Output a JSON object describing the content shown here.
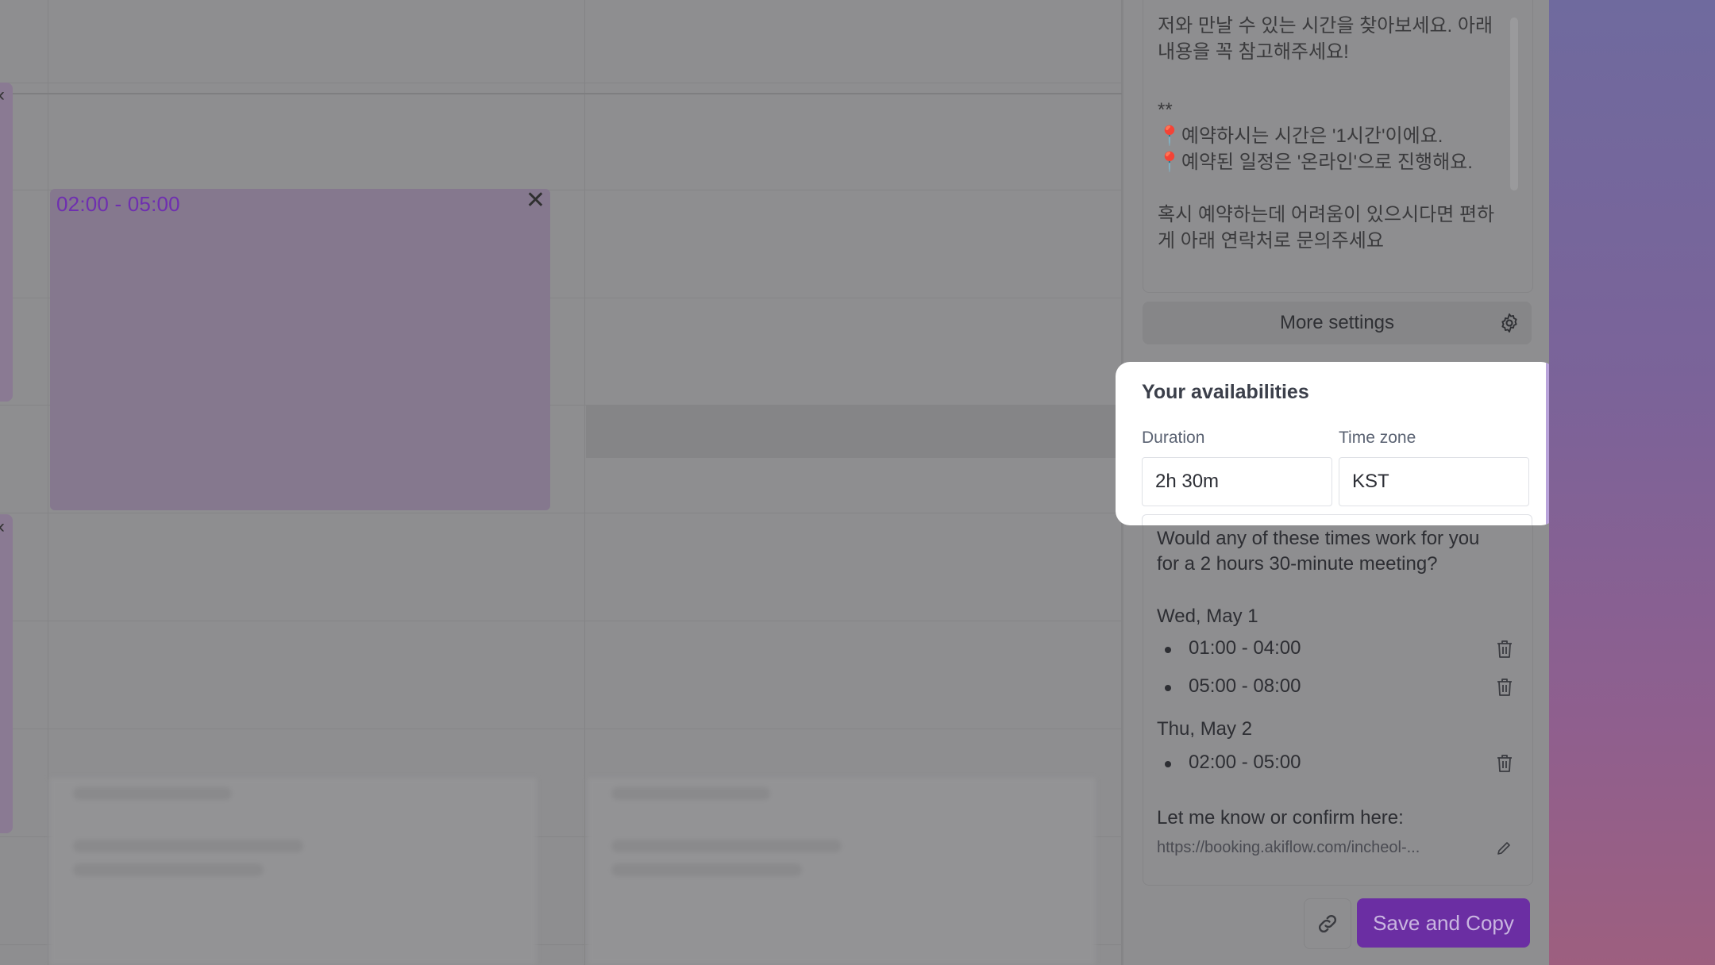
{
  "calendar": {
    "event_time": "02:00 - 05:00"
  },
  "description": {
    "lines": [
      "저와 만날 수 있는 시간을 찾아보세요. 아래 내용을 꼭 참고해주세요!",
      "**",
      "📍예약하시는 시간은 '1시간'이에요.",
      "📍예약된 일정은 '온라인'으로 진행해요.",
      "혹시 예약하는데 어려움이 있으시다면 편하게 아래 연락처로 문의주세요"
    ]
  },
  "more_settings_label": "More settings",
  "availabilities": {
    "title": "Your availabilities",
    "duration_label": "Duration",
    "duration_value": "2h 30m",
    "timezone_label": "Time zone",
    "timezone_value": "KST"
  },
  "message": {
    "intro": "Would any of these times work for you for a 2 hours 30-minute meeting?",
    "days": [
      {
        "label": "Wed, May 1",
        "slots": [
          "01:00 - 04:00",
          "05:00 - 08:00"
        ]
      },
      {
        "label": "Thu, May 2",
        "slots": [
          "02:00 - 05:00"
        ]
      }
    ],
    "confirm_label": "Let me know or confirm here:",
    "link": "https://booking.akiflow.com/incheol-..."
  },
  "actions": {
    "save_copy_label": "Save and Copy"
  },
  "icons": {
    "gear": "gear-icon",
    "trash": "trash-icon",
    "edit": "pencil-icon",
    "link": "link-icon",
    "close": "close-icon"
  },
  "colors": {
    "accent_purple": "#7b2fbf",
    "event_text": "#6f2fb0"
  }
}
